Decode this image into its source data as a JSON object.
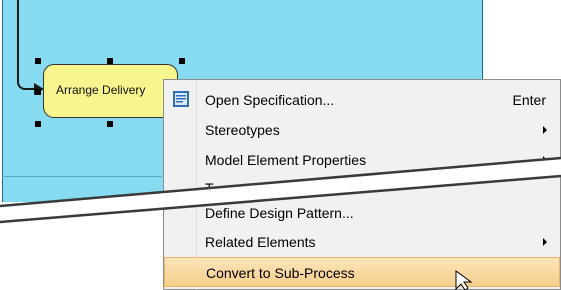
{
  "diagram": {
    "task": {
      "label": "Arrange Delivery"
    }
  },
  "context_menu": {
    "items": [
      {
        "label": "Open Specification...",
        "shortcut": "Enter",
        "icon": "specification-icon",
        "submenu": false
      },
      {
        "label": "Stereotypes",
        "shortcut": "",
        "submenu": true
      },
      {
        "label": "Model Element Properties",
        "shortcut": "",
        "submenu": true
      },
      {
        "label": "T",
        "shortcut": "",
        "submenu": false
      },
      {
        "label": "Define Design Pattern...",
        "shortcut": "",
        "submenu": false
      },
      {
        "label": "Related Elements",
        "shortcut": "",
        "submenu": true
      },
      {
        "label": "Convert to Sub-Process",
        "shortcut": "",
        "submenu": false,
        "highlighted": true
      }
    ]
  },
  "colors": {
    "lane": "#86dbf0",
    "task_fill": "#f7f58d",
    "highlight": "#f6cf8c"
  }
}
